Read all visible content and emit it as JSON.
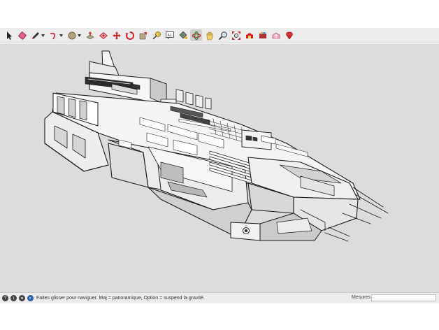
{
  "toolbar": {
    "tools": [
      {
        "name": "select-tool",
        "icon": "arrow-icon"
      },
      {
        "name": "eraser-tool",
        "icon": "eraser-icon"
      },
      {
        "name": "line-tool",
        "icon": "pencil-icon",
        "dropdown": true
      },
      {
        "name": "arc-tool",
        "icon": "arc-icon",
        "dropdown": true
      },
      {
        "name": "shape-tool",
        "icon": "circle-shape-icon",
        "dropdown": true
      },
      {
        "name": "push-pull-tool",
        "icon": "push-pull-icon"
      },
      {
        "name": "offset-tool",
        "icon": "offset-icon"
      },
      {
        "name": "move-tool",
        "icon": "move-icon"
      },
      {
        "name": "rotate-tool",
        "icon": "rotate-icon"
      },
      {
        "name": "scale-tool",
        "icon": "scale-icon"
      },
      {
        "name": "tape-measure-tool",
        "icon": "tape-measure-icon"
      },
      {
        "name": "text-tool",
        "icon": "text-icon"
      },
      {
        "name": "paint-bucket-tool",
        "icon": "paint-bucket-icon"
      },
      {
        "name": "orbit-tool",
        "icon": "orbit-icon",
        "active": true
      },
      {
        "name": "pan-tool",
        "icon": "hand-icon"
      },
      {
        "name": "zoom-tool",
        "icon": "zoom-icon"
      },
      {
        "name": "zoom-extents-tool",
        "icon": "zoom-extents-icon"
      },
      {
        "name": "warehouse-tool",
        "icon": "warehouse-icon"
      },
      {
        "name": "extension-tool",
        "icon": "extension-icon"
      },
      {
        "name": "share-model-tool",
        "icon": "share-model-icon"
      },
      {
        "name": "ruby-tool",
        "icon": "ruby-icon"
      }
    ]
  },
  "status": {
    "message": "Faites glisser pour naviguer. Maj = panoramique, Option =  suspend la gravité.",
    "measure_label": "Mesures",
    "measure_value": ""
  },
  "colors": {
    "viewport_bg": "#dcdcdc",
    "toolbar_bg": "#ececec",
    "accent_red": "#d2232a"
  }
}
